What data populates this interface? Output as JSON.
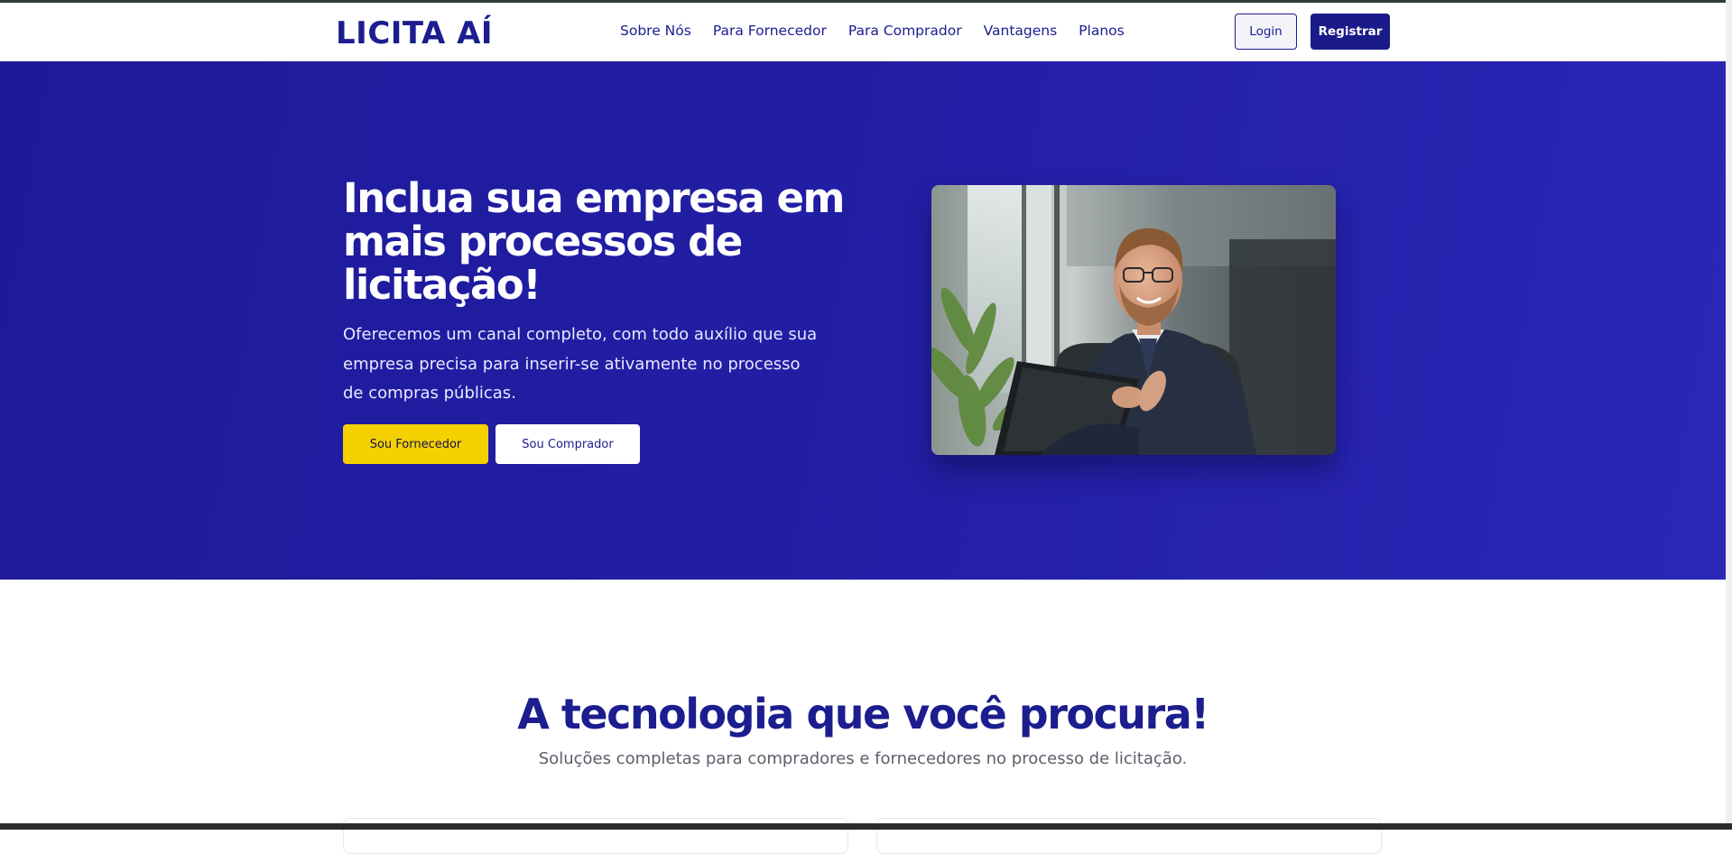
{
  "header": {
    "logo": "LICITA AÍ",
    "nav": [
      "Sobre Nós",
      "Para Fornecedor",
      "Para Comprador",
      "Vantagens",
      "Planos"
    ],
    "login_label": "Login",
    "register_label": "Registrar"
  },
  "hero": {
    "title": "Inclua sua empresa em mais processos de licitação!",
    "subtitle": "Oferecemos um canal completo, com todo auxílio que sua empresa precisa para inserir-se ativamente no processo de compras públicas.",
    "primary_button": "Sou Fornecedor",
    "secondary_button": "Sou Comprador"
  },
  "features": {
    "title": "A tecnologia que você procura!",
    "subtitle": "Soluções completas para compradores e fornecedores no processo de licitação."
  },
  "colors": {
    "brand": "#1c1d8f",
    "hero_bg": "#231fa6",
    "accent_yellow": "#f4d000"
  }
}
